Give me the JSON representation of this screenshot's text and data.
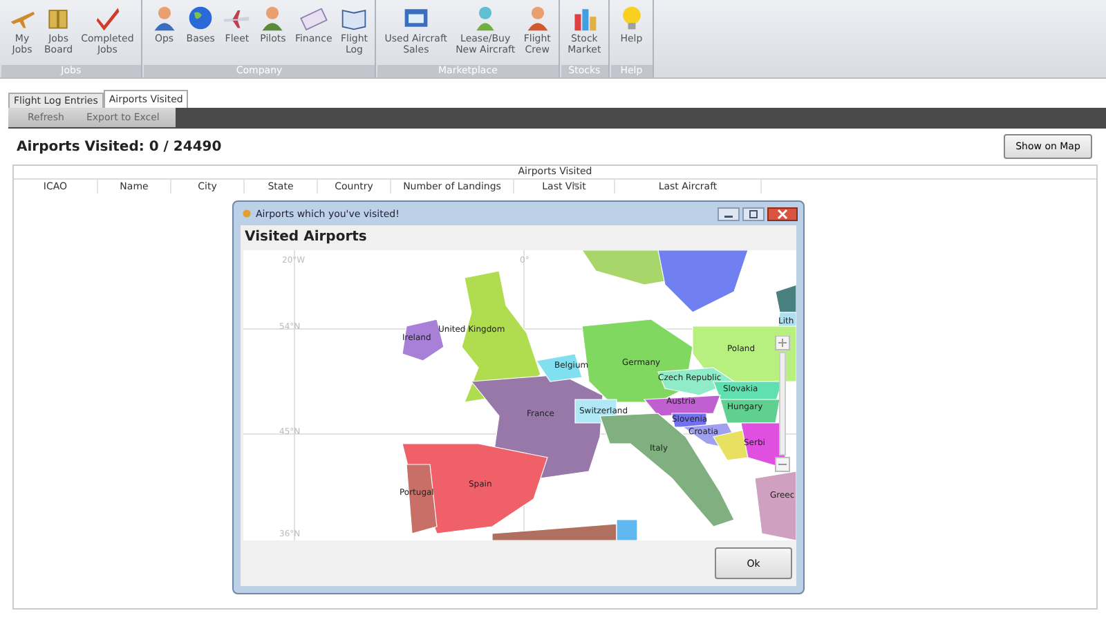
{
  "ribbon": {
    "groups": [
      {
        "label": "Jobs",
        "buttons": [
          "My\nJobs",
          "Jobs\nBoard",
          "Completed\nJobs"
        ]
      },
      {
        "label": "Company",
        "buttons": [
          "Ops",
          "Bases",
          "Fleet",
          "Pilots",
          "Finance",
          "Flight\nLog"
        ]
      },
      {
        "label": "Marketplace",
        "buttons": [
          "Used Aircraft\nSales",
          "Lease/Buy\nNew Aircraft",
          "Flight\nCrew"
        ]
      },
      {
        "label": "Stocks",
        "buttons": [
          "Stock\nMarket"
        ]
      },
      {
        "label": "Help",
        "buttons": [
          "Help"
        ]
      }
    ]
  },
  "tabs": [
    {
      "label": "Flight Log Entries",
      "selected": false
    },
    {
      "label": "Airports Visited",
      "selected": true
    }
  ],
  "toolbar": {
    "buttons": [
      "Refresh",
      "Export to Excel"
    ]
  },
  "summary": "Airports Visited: 0 / 24490",
  "show_map_button": "Show on Map",
  "table": {
    "group_header": "Airports Visited",
    "columns": [
      {
        "label": "ICAO",
        "sorted": false
      },
      {
        "label": "Name",
        "sorted": false
      },
      {
        "label": "City",
        "sorted": false
      },
      {
        "label": "State",
        "sorted": false
      },
      {
        "label": "Country",
        "sorted": false
      },
      {
        "label": "Number of Landings",
        "sorted": false
      },
      {
        "label": "Last Visit",
        "sorted": true
      },
      {
        "label": "Last Aircraft",
        "sorted": false
      }
    ]
  },
  "dialog": {
    "title": "Airports which you've visited!",
    "heading": "Visited Airports",
    "ok_button": "Ok",
    "map": {
      "grid_labels": [
        "20°W",
        "0°",
        "54°N",
        "45°N",
        "36°N"
      ],
      "country_labels": [
        "Lith",
        "Ireland",
        "United Kingdom",
        "Belgium",
        "Germany",
        "Poland",
        "Czech Republic",
        "Slovakia",
        "Austria",
        "Hungary",
        "France",
        "Switzerland",
        "Slovenia",
        "Croatia",
        "Serbi",
        "Italy",
        "Spain",
        "Portugal",
        "Greec"
      ]
    }
  }
}
